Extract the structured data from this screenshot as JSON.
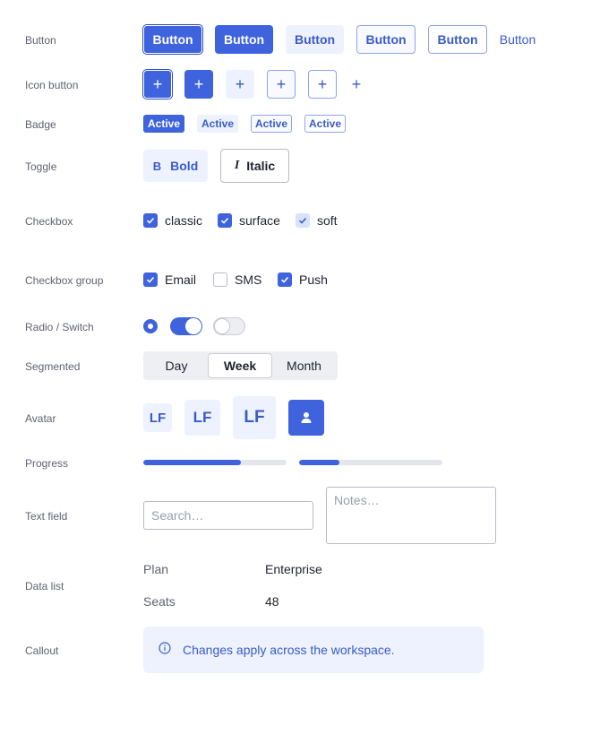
{
  "labels": {
    "button": "Button",
    "icon_button": "Icon button",
    "badge": "Badge",
    "toggle": "Toggle",
    "checkbox": "Checkbox",
    "checkbox_group": "Checkbox group",
    "radio_switch": "Radio / Switch",
    "segmented": "Segmented",
    "avatar": "Avatar",
    "progress": "Progress",
    "text_field": "Text field",
    "data_list": "Data list",
    "callout": "Callout"
  },
  "buttons": {
    "classic": "Button",
    "solid": "Button",
    "soft": "Button",
    "surface": "Button",
    "outline": "Button",
    "ghost": "Button"
  },
  "icon_buttons": {
    "glyph": "+"
  },
  "badges": {
    "solid": "Active",
    "soft": "Active",
    "surface": "Active",
    "outline": "Active"
  },
  "toggles": {
    "bold": {
      "icon": "B",
      "label": "Bold",
      "pressed": true
    },
    "italic": {
      "icon": "I",
      "label": "Italic",
      "pressed": false
    }
  },
  "checkboxes": {
    "classic": {
      "label": "classic",
      "checked": true
    },
    "surface": {
      "label": "surface",
      "checked": true
    },
    "soft": {
      "label": "soft",
      "checked": true
    }
  },
  "checkbox_group": [
    {
      "label": "Email",
      "checked": true
    },
    {
      "label": "SMS",
      "checked": false
    },
    {
      "label": "Push",
      "checked": true
    }
  ],
  "radio_switch": {
    "radio_checked": true,
    "switch_on": true,
    "switch2_on": false
  },
  "segmented": {
    "options": [
      "Day",
      "Week",
      "Month"
    ],
    "selected": "Week"
  },
  "avatars": {
    "initials": "LF"
  },
  "progress": [
    {
      "value": 0.68
    },
    {
      "value": 0.28
    }
  ],
  "text_fields": {
    "search_placeholder": "Search…",
    "notes_placeholder": "Notes…"
  },
  "data_list": [
    {
      "key": "Plan",
      "value": "Enterprise"
    },
    {
      "key": "Seats",
      "value": "48"
    }
  ],
  "callout": {
    "text": "Changes apply across the workspace."
  },
  "colors": {
    "accent": "#3e63dd",
    "accent_soft": "#edf2fe",
    "accent_text": "#3a5bc7",
    "callout_bg": "#edf2fe"
  }
}
